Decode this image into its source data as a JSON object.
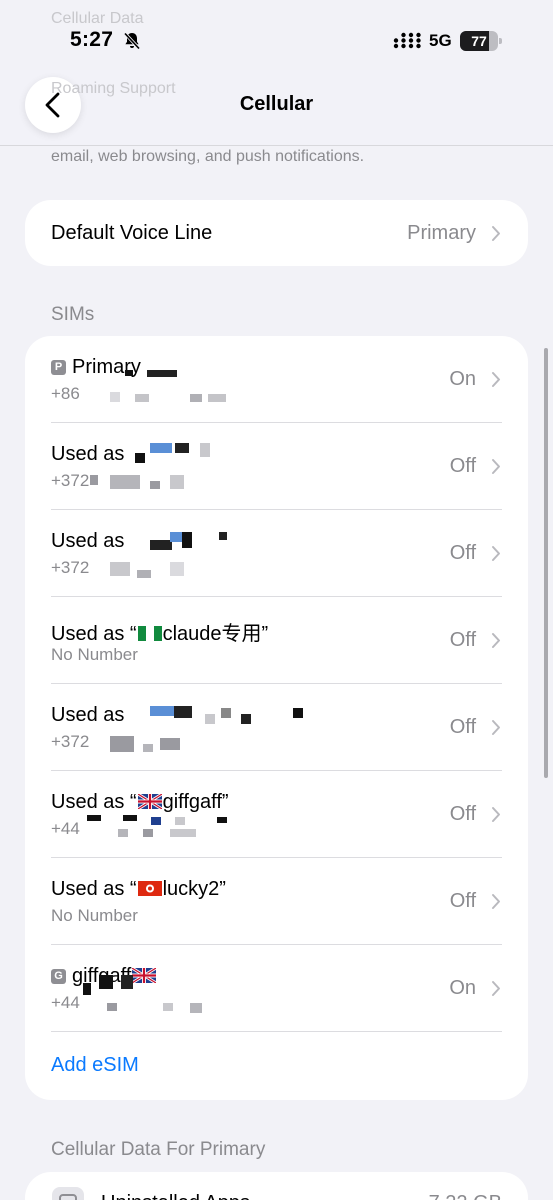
{
  "status_bar": {
    "time": "5:27",
    "network": "5G",
    "battery_level": "77",
    "battery_fraction": 0.77
  },
  "nav": {
    "title": "Cellular"
  },
  "behind": {
    "line1": "Cellular Data",
    "line2": "Roaming Support"
  },
  "top_footer": "email, web browsing, and push notifications.",
  "default_voice": {
    "label": "Default Voice Line",
    "value": "Primary"
  },
  "sims_header": "SIMs",
  "sims": [
    {
      "badge": "P",
      "title": "Primary",
      "sub": "+86",
      "status": "On"
    },
    {
      "title": "Used as",
      "sub": "+372",
      "status": "Off"
    },
    {
      "title": "Used as",
      "sub": "+372",
      "status": "Off"
    },
    {
      "title_prefix": "Used as “",
      "flag": "nigeria-flag",
      "title_name": "claude专用”",
      "sub": "No Number",
      "status": "Off"
    },
    {
      "title": "Used as",
      "sub": "+372",
      "status": "Off"
    },
    {
      "title_prefix": "Used as “",
      "flag": "uk-flag",
      "title_name": "giffgaff”",
      "sub": "+44",
      "status": "Off"
    },
    {
      "title_prefix": "Used as “",
      "flag": "hongkong-flag",
      "title_name": "lucky2”",
      "sub": "No Number",
      "status": "Off"
    },
    {
      "badge": "G",
      "title": "giffgaff",
      "flag": "uk-flag",
      "sub": "+44",
      "status": "On"
    }
  ],
  "add_esim": "Add eSIM",
  "data_header": "Cellular Data For Primary",
  "bottom_row": {
    "label": "Uninstalled Apps",
    "value": "7.22 GB"
  },
  "colors": {
    "accent": "#0a7aff",
    "background": "#f2f2f7",
    "secondary_text": "#8a8a8e"
  }
}
